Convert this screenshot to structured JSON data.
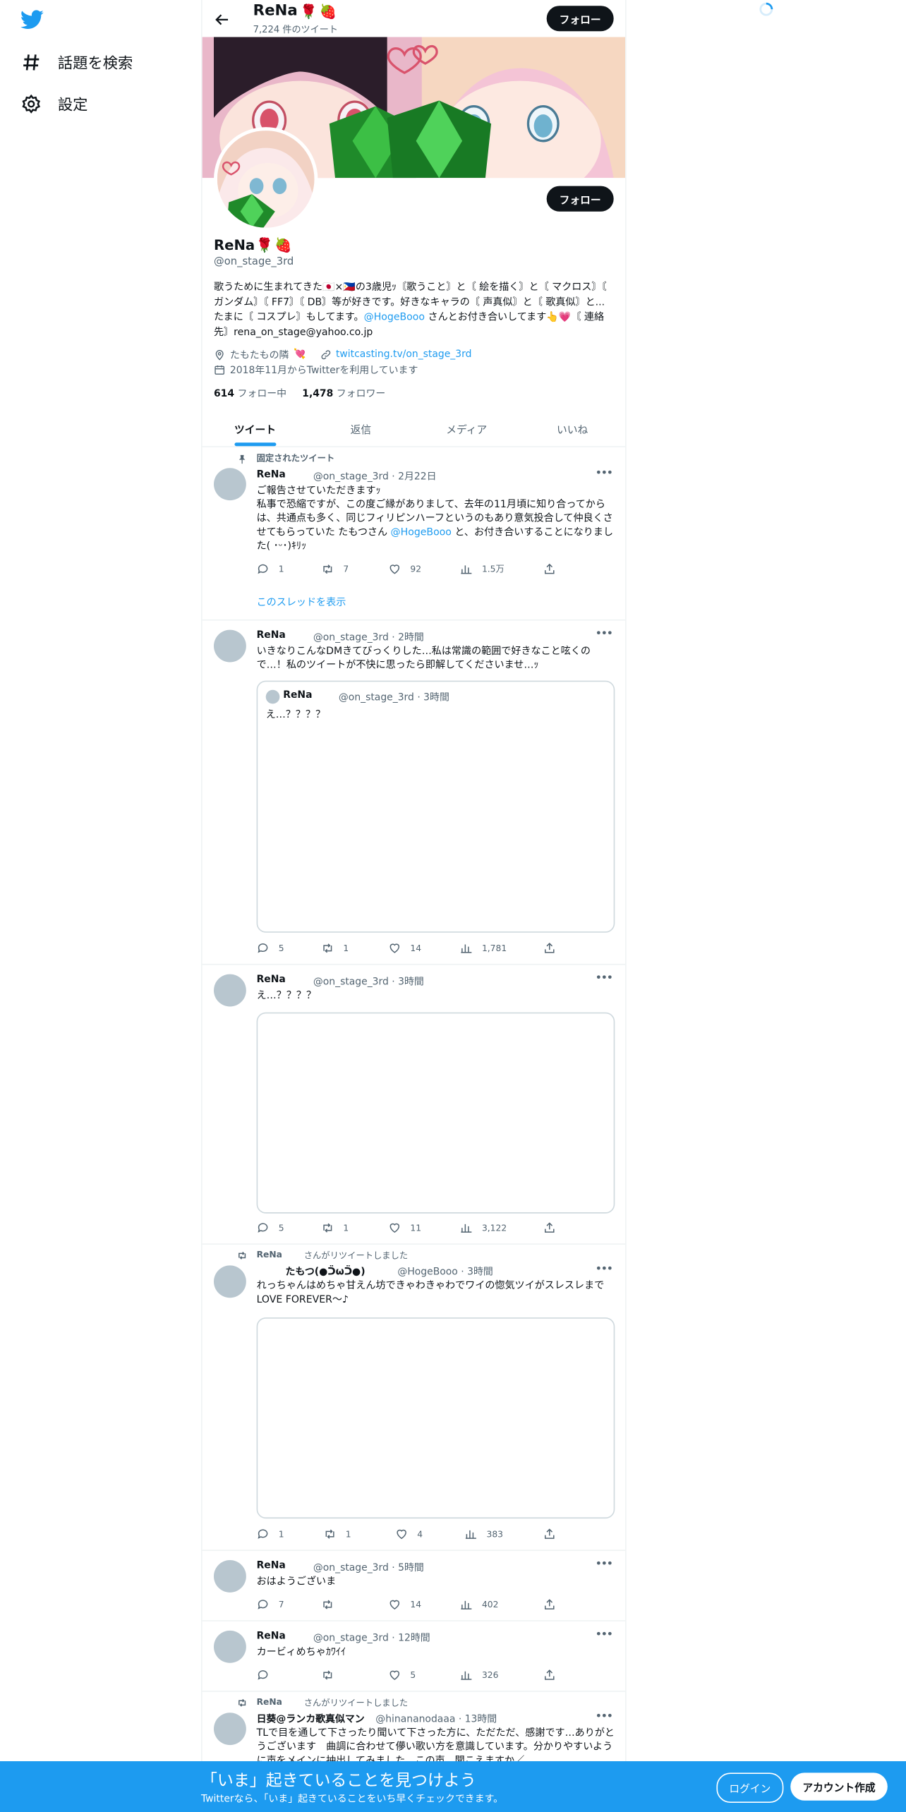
{
  "nav": {
    "explore_label": "話題を検索",
    "settings_label": "設定"
  },
  "header": {
    "name": "ReNa",
    "tweet_count": "7,224 件のツイート",
    "follow_label": "フォロー"
  },
  "profile": {
    "name": "ReNa",
    "handle": "@on_stage_3rd",
    "follow_label": "フォロー",
    "bio_1": "歌うために生まれてきた",
    "bio_2": "の3歳児ｯ〘歌うこと〙と〘 絵を描く〙と〘 マクロス〙〘 ガンダム〙〘 FF7〙〘 DB〙等が好きです。好きなキャラの〘 声真似〙と〘 歌真似〙と...たまに〘 コスプレ〙もしてます。",
    "bio_mention": "@HogeBooo",
    "bio_3": " さんとお付き合いしてます",
    "bio_4": "〘 連絡先〙rena_on_stage@yahoo.co.jp",
    "location": "たもたもの隣",
    "website": "twitcasting.tv/on_stage_3rd",
    "joined": "2018年11月からTwitterを利用しています",
    "following_count": "614",
    "following_label": "フォロー中",
    "followers_count": "1,478",
    "followers_label": "フォロワー"
  },
  "tabs": [
    "ツイート",
    "返信",
    "メディア",
    "いいね"
  ],
  "pinned_label": "固定されたツイート",
  "thread_label": "このスレッドを表示",
  "retweet_label": "さんがリツイートしました",
  "tweets": [
    {
      "name": "ReNa",
      "handle": "@on_stage_3rd",
      "time": "· 2月22日",
      "text_1": "ご報告させていただきますｯ",
      "text_2": "私事で恐縮ですが、この度ご縁がありまして、去年の11月頃に知り合ってからは、共通点も多く、同じフィリピンハーフというのもあり意気投合して仲良くさせてもらっていた たもつさん ",
      "mention": "@HogeBooo",
      "text_3": " と、お付き合いすることになりました( ･ᵕ･)ｷﾘｯ",
      "reply": "1",
      "retweet": "7",
      "like": "92",
      "views": "1.5万"
    },
    {
      "name": "ReNa",
      "handle": "@on_stage_3rd",
      "time": "· 2時間",
      "text": "いきなりこんなDMきてびっくりした…私は常識の範囲で好きなこと呟くので…！私のツイートが不快に思ったら即解してくださいませ…ｯ",
      "quote_name": "ReNa",
      "quote_handle": "@on_stage_3rd",
      "quote_time": "· 3時間",
      "quote_text": "え…？？？？",
      "reply": "5",
      "retweet": "1",
      "like": "14",
      "views": "1,781"
    },
    {
      "name": "ReNa",
      "handle": "@on_stage_3rd",
      "time": "· 3時間",
      "text": "え…？？？？",
      "reply": "5",
      "retweet": "1",
      "like": "11",
      "views": "3,122"
    },
    {
      "retweeter": "ReNa",
      "name": "たもつ(●ᑒωᑒ●)",
      "handle": "@HogeBooo",
      "time": "· 3時間",
      "text": "れっちゃんはめちゃ甘えん坊できゃわきゃわでワイの惚気ツイがスレスレまでLOVE FOREVER〜♪",
      "reply": "1",
      "retweet": "1",
      "like": "4",
      "views": "383"
    },
    {
      "name": "ReNa",
      "handle": "@on_stage_3rd",
      "time": "· 5時間",
      "text": "おはようございま",
      "reply": "7",
      "retweet": "",
      "like": "14",
      "views": "402"
    },
    {
      "name": "ReNa",
      "handle": "@on_stage_3rd",
      "time": "· 12時間",
      "text": "カービィめちゃｶﾜｲｲ",
      "reply": "",
      "retweet": "",
      "like": "5",
      "views": "326"
    },
    {
      "retweeter": "ReNa",
      "name": "日葵@ランカ歌真似マン",
      "handle": "@hinananodaaa",
      "time": "· 13時間",
      "text": "TLで目を通して下さったり聞いて下さった方に、ただただ、感謝です…ありがとうございます　曲調に合わせて儚い歌い方を意識しています。分かりやすいように声をメインに抽出してみました。この声、聞こえますか／"
    }
  ],
  "bottom_bar": {
    "title": "「いま」起きていることを見つけよう",
    "subtitle": "Twitterなら、「いま」起きていることをいち早くチェックできます。",
    "login_label": "ログイン",
    "signup_label": "アカウント作成"
  },
  "colors": {
    "accent": "#1d9bf0",
    "text": "#0f1419",
    "muted": "#536471",
    "border": "#eff3f4"
  }
}
